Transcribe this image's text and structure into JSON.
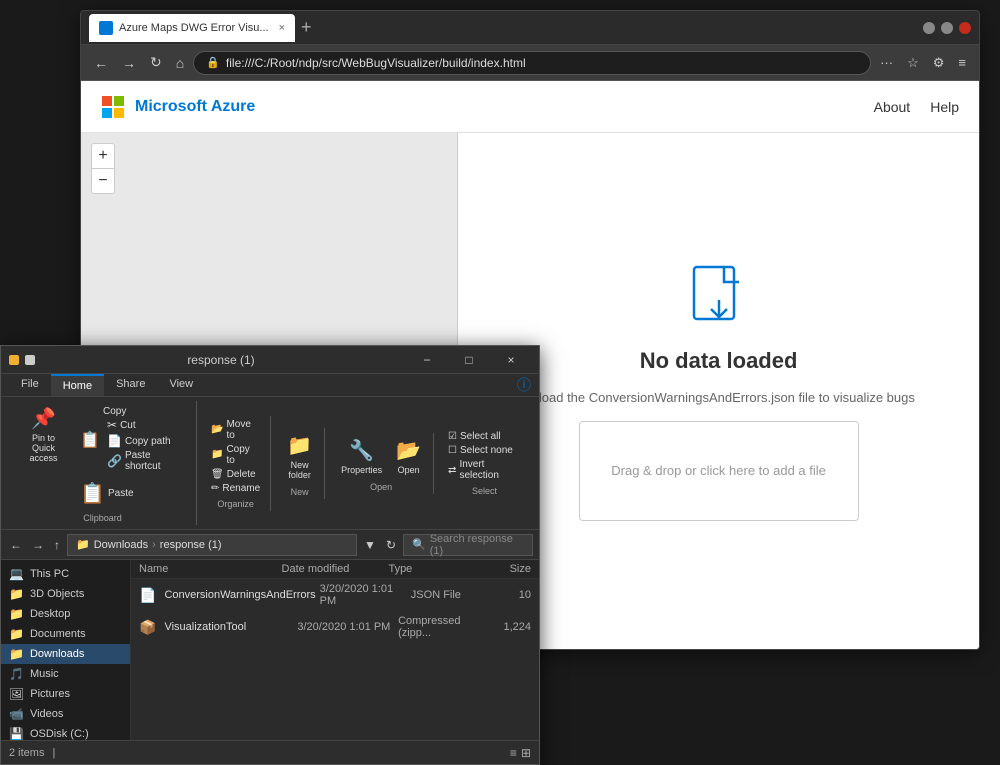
{
  "browser": {
    "tab_title": "Azure Maps DWG Error Visu...",
    "tab_close": "×",
    "new_tab": "+",
    "address": "file:///C:/Root/ndp/src/WebBugVisualizer/build/index.html",
    "nav_back": "←",
    "nav_forward": "→",
    "nav_refresh": "↻",
    "nav_home": "⌂",
    "more_btn": "···",
    "fav_btn": "☆",
    "settings_btn": "⚙",
    "menu_btn": "≡"
  },
  "azure": {
    "logo_text": "Microsoft Azure",
    "nav_about": "About",
    "nav_help": "Help",
    "map_zoom_in": "+",
    "map_zoom_out": "−",
    "no_data_title": "No data loaded",
    "no_data_subtitle": "Upload the ConversionWarningsAndErrors.json file to visualize bugs",
    "drop_zone_text": "Drag & drop or click here to add a file"
  },
  "explorer": {
    "title": "response (1)",
    "btn_minimize": "−",
    "btn_maximize": "□",
    "btn_close": "×",
    "tabs": [
      "File",
      "Home",
      "Share",
      "View"
    ],
    "active_tab": "Home",
    "ribbon": {
      "clipboard_group": "Clipboard",
      "organize_group": "Organize",
      "new_group": "New",
      "open_group": "Open",
      "select_group": "Select",
      "pin_to_quick": "Pin to Quick\naccess",
      "copy_label": "Copy",
      "paste_label": "Paste",
      "cut_label": "Cut",
      "copy_path_label": "Copy path",
      "paste_shortcut_label": "Paste shortcut",
      "move_to_label": "Move to",
      "copy_to_label": "Copy to",
      "delete_label": "Delete",
      "rename_label": "Rename",
      "new_folder_label": "New\nfolder",
      "properties_label": "Properties",
      "open_label": "Open",
      "select_all_label": "Select all",
      "select_none_label": "Select none",
      "invert_selection_label": "Invert selection"
    },
    "path": "Downloads › response (1)",
    "search_placeholder": "Search response (1)",
    "columns": {
      "name": "Name",
      "date_modified": "Date modified",
      "type": "Type",
      "size": "Size"
    },
    "files": [
      {
        "name": "ConversionWarningsAndErrors",
        "date": "3/20/2020 1:01 PM",
        "type": "JSON File",
        "size": "10"
      },
      {
        "name": "VisualizationTool",
        "date": "3/20/2020 1:01 PM",
        "type": "Compressed (zipp...",
        "size": "1,224"
      }
    ],
    "sidebar_items": [
      {
        "label": "This PC",
        "icon": "💻"
      },
      {
        "label": "3D Objects",
        "icon": "📁"
      },
      {
        "label": "Desktop",
        "icon": "📁"
      },
      {
        "label": "Documents",
        "icon": "📁"
      },
      {
        "label": "Downloads",
        "icon": "📁"
      },
      {
        "label": "Music",
        "icon": "🎵"
      },
      {
        "label": "Pictures",
        "icon": "🖼"
      },
      {
        "label": "Videos",
        "icon": "📹"
      },
      {
        "label": "OSDisk (C:)",
        "icon": "💾"
      }
    ],
    "status_items_count": "2 items",
    "status_separator": "|"
  }
}
